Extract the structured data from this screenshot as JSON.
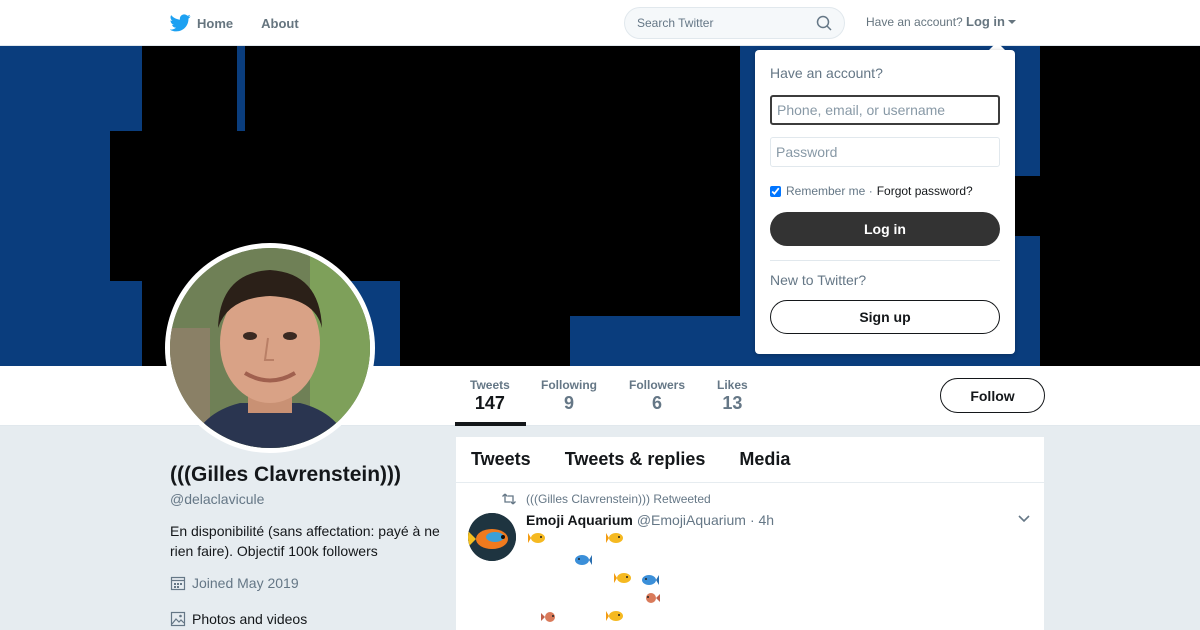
{
  "nav": {
    "home_label": "Home",
    "about_label": "About",
    "search_placeholder": "Search Twitter",
    "have_account": "Have an account?",
    "login_label": "Log in"
  },
  "profile": {
    "name": "(((Gilles Clavrenstein)))",
    "handle": "@delaclavicule",
    "bio": "En disponibilité (sans affectation: payé à ne rien faire). Objectif 100k followers",
    "joined": "Joined May 2019",
    "photos_label": "Photos and videos",
    "follow_label": "Follow"
  },
  "stats": [
    {
      "label": "Tweets",
      "value": "147"
    },
    {
      "label": "Following",
      "value": "9"
    },
    {
      "label": "Followers",
      "value": "6"
    },
    {
      "label": "Likes",
      "value": "13"
    }
  ],
  "timeline": {
    "tabs": [
      "Tweets",
      "Tweets & replies",
      "Media"
    ],
    "tweet": {
      "retweet_context": "(((Gilles Clavrenstein))) Retweeted",
      "author_name": "Emoji Aquarium",
      "author_handle": "@EmojiAquarium",
      "time": "· 4h"
    }
  },
  "login_dropdown": {
    "title": "Have an account?",
    "username_placeholder": "Phone, email, or username",
    "password_placeholder": "Password",
    "remember_label": "Remember me ·",
    "forgot_label": "Forgot password?",
    "login_button": "Log in",
    "new_to_twitter": "New to Twitter?",
    "signup_button": "Sign up"
  },
  "colors": {
    "brand": "#1da1f2",
    "banner": "#0a3d7d",
    "text": "#14171a",
    "muted": "#657786"
  }
}
